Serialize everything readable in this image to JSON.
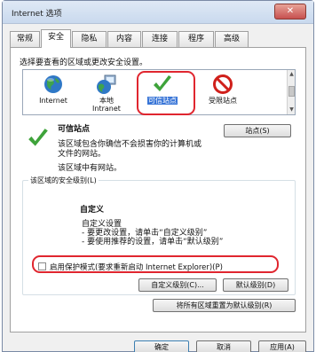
{
  "window": {
    "title": "Internet 选项",
    "close_label": "✕"
  },
  "tabs": [
    {
      "label": "常规",
      "active": false
    },
    {
      "label": "安全",
      "active": true
    },
    {
      "label": "隐私",
      "active": false
    },
    {
      "label": "内容",
      "active": false
    },
    {
      "label": "连接",
      "active": false
    },
    {
      "label": "程序",
      "active": false
    },
    {
      "label": "高级",
      "active": false
    }
  ],
  "security": {
    "prompt": "选择要查看的区域或更改安全设置。",
    "zones": [
      {
        "label_line1": "Internet",
        "label_line2": "",
        "icon": "globe-icon",
        "selected": false
      },
      {
        "label_line1": "本地",
        "label_line2": "Intranet",
        "icon": "intranet-globe-icon",
        "selected": false
      },
      {
        "label_line1": "可信站点",
        "label_line2": "",
        "icon": "checkmark-icon",
        "selected": true
      },
      {
        "label_line1": "受限站点",
        "label_line2": "",
        "icon": "restricted-icon",
        "selected": false
      }
    ],
    "selected_zone": {
      "title": "可信站点",
      "desc_line1": "该区域包含你确信不会损害你的计算机或",
      "desc_line2": "文件的网站。",
      "no_sites": "该区域中有网站。"
    },
    "sites_button": "站点(S)",
    "level_group": {
      "title": "该区域的安全级别(L)",
      "level_name": "自定义",
      "level_sub": "自定义设置",
      "bullet1": "- 要更改设置，请单击“自定义级别”",
      "bullet2": "- 要使用推荐的设置，请单击“默认级别”",
      "protected_mode": "启用保护模式(要求重新启动 Internet Explorer)(P)",
      "protected_mode_checked": false,
      "custom_level_button": "自定义级别(C)...",
      "default_level_button": "默认级别(D)"
    },
    "reset_all_button": "将所有区域重置为默认级别(R)"
  },
  "footer": {
    "ok": "确定",
    "cancel": "取消",
    "apply": "应用(A)"
  },
  "colors": {
    "highlight_red": "#e0262f",
    "selection_blue": "#3875d7",
    "check_green": "#3ea33a"
  }
}
